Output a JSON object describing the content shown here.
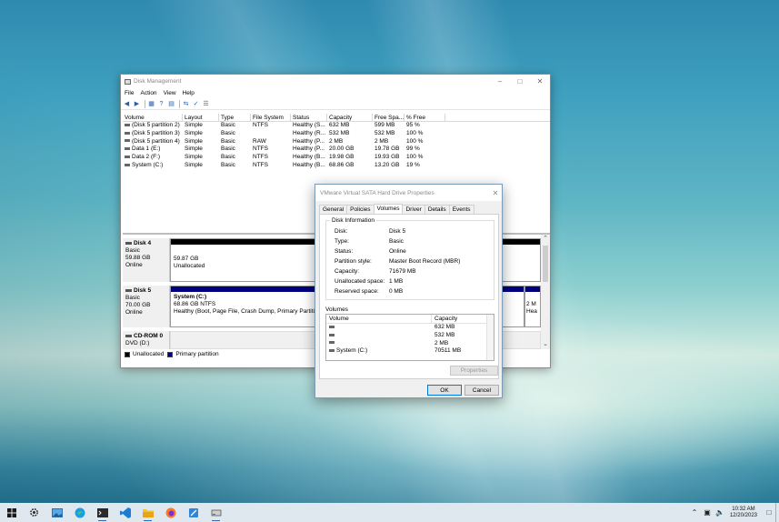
{
  "disk_management": {
    "title": "Disk Management",
    "menu": [
      "File",
      "Action",
      "View",
      "Help"
    ],
    "columns": [
      "Volume",
      "Layout",
      "Type",
      "File System",
      "Status",
      "Capacity",
      "Free Spa...",
      "% Free"
    ],
    "rows": [
      [
        "(Disk 5 partition 2)",
        "Simple",
        "Basic",
        "NTFS",
        "Healthy (S...",
        "632 MB",
        "599 MB",
        "95 %"
      ],
      [
        "(Disk 5 partition 3)",
        "Simple",
        "Basic",
        "",
        "Healthy (R...",
        "532 MB",
        "532 MB",
        "100 %"
      ],
      [
        "(Disk 5 partition 4)",
        "Simple",
        "Basic",
        "RAW",
        "Healthy (P...",
        "2 MB",
        "2 MB",
        "100 %"
      ],
      [
        "Data 1 (E:)",
        "Simple",
        "Basic",
        "NTFS",
        "Healthy (P...",
        "20.00 GB",
        "19.78 GB",
        "99 %"
      ],
      [
        "Data 2 (F:)",
        "Simple",
        "Basic",
        "NTFS",
        "Healthy (B...",
        "19.98 GB",
        "19.93 GB",
        "100 %"
      ],
      [
        "System (C:)",
        "Simple",
        "Basic",
        "NTFS",
        "Healthy (B...",
        "68.86 GB",
        "13.20 GB",
        "19 %"
      ]
    ],
    "disks": {
      "disk4": {
        "name": "Disk 4",
        "type": "Basic",
        "size": "59.88 GB",
        "status": "Online",
        "part_size": "59.87 GB",
        "part_state": "Unallocated"
      },
      "disk5": {
        "name": "Disk 5",
        "type": "Basic",
        "size": "70.00 GB",
        "status": "Online",
        "part_name": "System  (C:)",
        "part_size": "68.86 GB NTFS",
        "part_state": "Healthy (Boot, Page File, Crash Dump, Primary Partition)",
        "small_size": "2 M",
        "small_state": "Hea"
      },
      "cdrom": {
        "name": "CD-ROM 0",
        "label": "DVD (D:)"
      }
    },
    "legend": {
      "unallocated": "Unallocated",
      "primary": "Primary partition"
    },
    "colors": {
      "unallocated": "#000000",
      "primary": "#00007f"
    }
  },
  "dialog": {
    "title": "VMware Virtual SATA Hard Drive Properties",
    "tabs": [
      "General",
      "Policies",
      "Volumes",
      "Driver",
      "Details",
      "Events"
    ],
    "active_tab": "Volumes",
    "group_title": "Disk Information",
    "info": [
      {
        "k": "Disk:",
        "v": "Disk 5"
      },
      {
        "k": "Type:",
        "v": "Basic"
      },
      {
        "k": "Status:",
        "v": "Online"
      },
      {
        "k": "Partition style:",
        "v": "Master Boot Record (MBR)"
      },
      {
        "k": "Capacity:",
        "v": "71679 MB"
      },
      {
        "k": "Unallocated space:",
        "v": "1 MB"
      },
      {
        "k": "Reserved space:",
        "v": "0 MB"
      }
    ],
    "volumes_label": "Volumes",
    "vol_columns": [
      "Volume",
      "Capacity"
    ],
    "vol_rows": [
      {
        "name": "",
        "cap": "632 MB"
      },
      {
        "name": "",
        "cap": "532 MB"
      },
      {
        "name": "",
        "cap": "2 MB"
      },
      {
        "name": "System (C:)",
        "cap": "70511 MB"
      }
    ],
    "properties_btn": "Properties",
    "ok": "OK",
    "cancel": "Cancel"
  },
  "taskbar": {
    "time": "10:32 AM",
    "date": "12/20/2023",
    "icons": [
      "windows-start-icon",
      "settings-icon",
      "photos-icon",
      "edge-icon",
      "terminal-icon",
      "vscode-icon",
      "file-explorer-icon",
      "firefox-icon",
      "snipping-icon",
      "disk-management-icon"
    ]
  }
}
